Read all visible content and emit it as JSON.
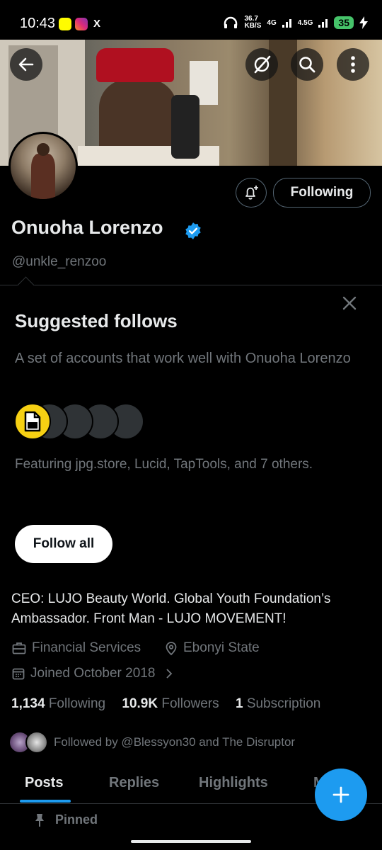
{
  "status_bar": {
    "time": "10:43",
    "x_icon": "X",
    "net_speed_value": "36.7",
    "net_speed_unit": "KB/S",
    "net_type_1": "4G",
    "net_type_2": "4.5G",
    "battery": "35",
    "battery_color": "#46c36a"
  },
  "profile": {
    "name": "Onuoha Lorenzo",
    "handle": "@unkle_renzoo",
    "verified_color": "#1d9bf0",
    "following_button": "Following"
  },
  "suggested": {
    "title": "Suggested follows",
    "description": "A set of accounts that work well with Onuoha Lorenzo",
    "featuring": "Featuring jpg.store, Lucid, TapTools, and 7 others.",
    "follow_all": "Follow all"
  },
  "bio": {
    "text": "CEO: LUJO Beauty World. Global Youth Foundation’s Ambassador. Front Man - LUJO MOVEMENT!",
    "category": "Financial Services",
    "location": "Ebonyi State",
    "joined": "Joined October 2018"
  },
  "stats": {
    "following_count": "1,134",
    "following_label": "Following",
    "followers_count": "10.9K",
    "followers_label": "Followers",
    "subscription_count": "1",
    "subscription_label": "Subscription"
  },
  "followed_by": "Followed by @Blessyon30 and The Disruptor",
  "tabs": [
    {
      "label": "Posts"
    },
    {
      "label": "Replies"
    },
    {
      "label": "Highlights"
    },
    {
      "label": "M"
    }
  ],
  "pinned_label": "Pinned",
  "accent_color": "#1d9bf0"
}
